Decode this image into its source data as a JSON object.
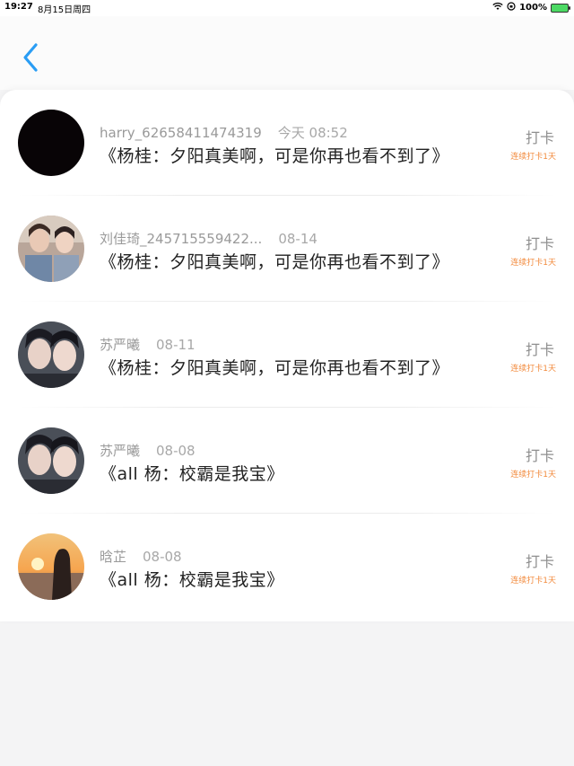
{
  "status_bar": {
    "time": "19:27",
    "date": "8月15日周四",
    "battery": "100%",
    "battery_color": "#4cd964"
  },
  "nav": {
    "back_icon": "chevron-left-icon",
    "accent": "#2a9df4"
  },
  "items": [
    {
      "user": "harry_62658411474319",
      "time": "今天 08:52",
      "title": "《杨桂：夕阳真美啊，可是你再也看不到了》",
      "action": "打卡",
      "streak": "连续打卡1天",
      "avatar": "black-avatar"
    },
    {
      "user": "刘佳琦_245715559422...",
      "time": "08-14",
      "title": "《杨桂：夕阳真美啊，可是你再也看不到了》",
      "action": "打卡",
      "streak": "连续打卡1天",
      "avatar": "photo-avatar-two-people"
    },
    {
      "user": "苏严曦",
      "time": "08-11",
      "title": "《杨桂：夕阳真美啊，可是你再也看不到了》",
      "action": "打卡",
      "streak": "连续打卡1天",
      "avatar": "photo-avatar-two-faces"
    },
    {
      "user": "苏严曦",
      "time": "08-08",
      "title": "《all 杨：校霸是我宝》",
      "action": "打卡",
      "streak": "连续打卡1天",
      "avatar": "photo-avatar-two-faces"
    },
    {
      "user": "晗芷",
      "time": "08-08",
      "title": "《all 杨：校霸是我宝》",
      "action": "打卡",
      "streak": "连续打卡1天",
      "avatar": "photo-avatar-sunset"
    }
  ]
}
